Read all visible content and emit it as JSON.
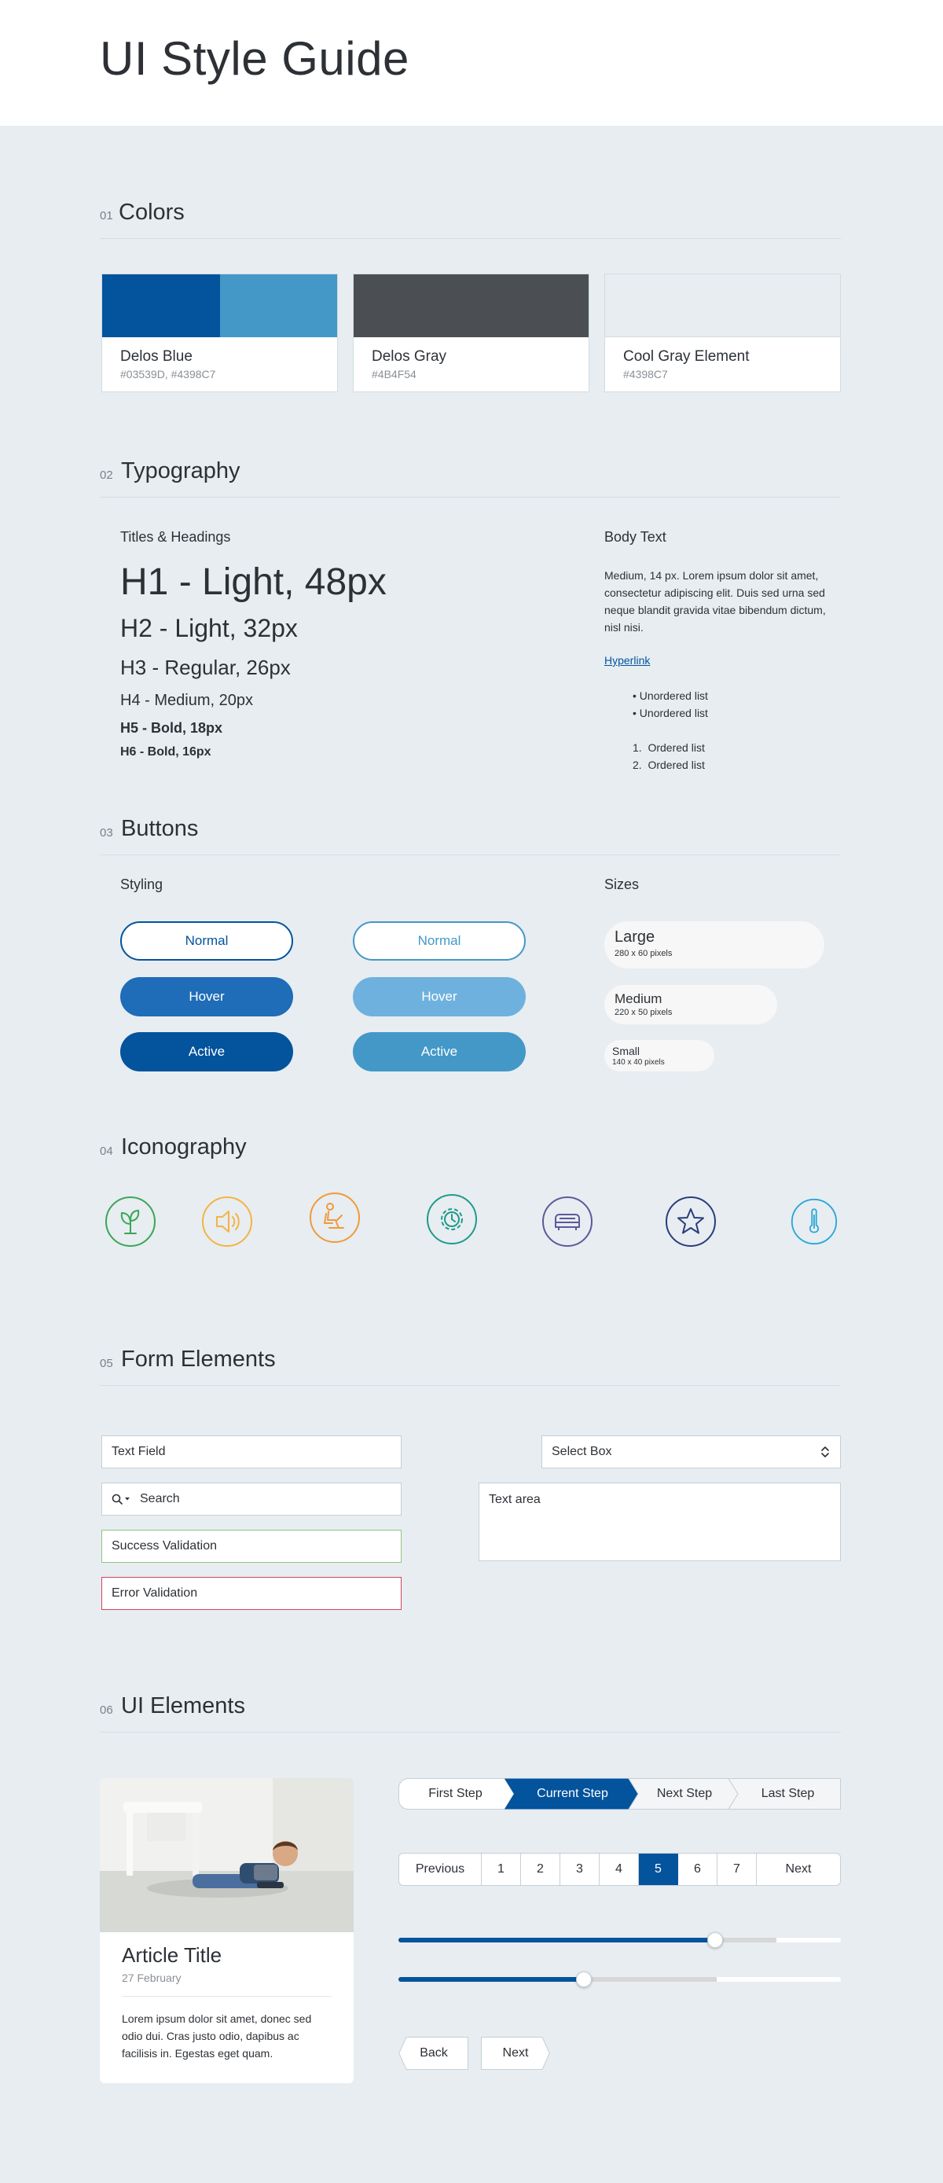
{
  "page": {
    "title": "UI Style Guide"
  },
  "colors_section": {
    "number": "01",
    "title": "Colors",
    "swatches": [
      {
        "name": "Delos Blue",
        "hex_label": "#03539D, #4398C7",
        "colors": [
          "#03539d",
          "#4398c7"
        ]
      },
      {
        "name": "Delos Gray",
        "hex_label": "#4B4F54",
        "colors": [
          "#4b4f54"
        ]
      },
      {
        "name": "Cool Gray Element",
        "hex_label": "#4398C7",
        "colors": [
          "#e7edf1"
        ]
      }
    ]
  },
  "typography_section": {
    "number": "02",
    "title": "Typography",
    "headings_label": "Titles & Headings",
    "h1": "H1 - Light, 48px",
    "h2": "H2 - Light, 32px",
    "h3": "H3 - Regular, 26px",
    "h4": "H4 - Medium, 20px",
    "h5": "H5 - Bold, 18px",
    "h6": "H6 - Bold, 16px",
    "body_label": "Body Text",
    "body_text": "Medium, 14 px. Lorem ipsum dolor sit amet, consectetur adipiscing elit. Duis sed urna sed neque blandit gravida vitae bibendum dictum, nisl nisi.",
    "hyperlink": "Hyperlink",
    "unordered": [
      "Unordered list",
      "Unordered list"
    ],
    "ordered": [
      "Ordered list",
      "Ordered list"
    ]
  },
  "buttons_section": {
    "number": "03",
    "title": "Buttons",
    "styling_label": "Styling",
    "sizes_label": "Sizes",
    "dark": {
      "normal": "Normal",
      "hover": "Hover",
      "active": "Active"
    },
    "light": {
      "normal": "Normal",
      "hover": "Hover",
      "active": "Active"
    },
    "sizes": [
      {
        "name": "Large",
        "dims": "280 x 60 pixels"
      },
      {
        "name": "Medium",
        "dims": "220 x 50 pixels"
      },
      {
        "name": "Small",
        "dims": "140 x 40 pixels"
      }
    ]
  },
  "iconography_section": {
    "number": "04",
    "title": "Iconography",
    "icons": [
      {
        "name": "plant-icon",
        "color": "#3aa655"
      },
      {
        "name": "speaker-icon",
        "color": "#f5b342"
      },
      {
        "name": "person-chair-icon",
        "color": "#f2993a"
      },
      {
        "name": "gear-clock-icon",
        "color": "#1f9a8a"
      },
      {
        "name": "bed-icon",
        "color": "#5a5a9a"
      },
      {
        "name": "star-icon",
        "color": "#2a3d7a"
      },
      {
        "name": "thermometer-icon",
        "color": "#2aa5d8"
      }
    ]
  },
  "forms_section": {
    "number": "05",
    "title": "Form Elements",
    "text_field": "Text Field",
    "search": "Search",
    "success": "Success Validation",
    "error": "Error Validation",
    "select_box": "Select Box",
    "text_area": "Text area"
  },
  "ui_section": {
    "number": "06",
    "title": "UI Elements",
    "article": {
      "title": "Article Title",
      "date": "27 February",
      "body": "Lorem ipsum dolor sit amet, donec sed odio dui. Cras justo odio, dapibus ac facilisis in. Egestas eget quam."
    },
    "steps": [
      "First Step",
      "Current Step",
      "Next Step",
      "Last Step"
    ],
    "pagination": {
      "previous": "Previous",
      "pages": [
        "1",
        "2",
        "3",
        "4",
        "5",
        "6",
        "7"
      ],
      "current": "5",
      "next": "Next"
    },
    "sliders": [
      {
        "value_fraction": 0.715,
        "buffer_fraction": 0.855
      },
      {
        "value_fraction": 0.42,
        "buffer_fraction": 0.72
      }
    ],
    "nav_buttons": {
      "back": "Back",
      "next": "Next"
    }
  },
  "theme": {
    "primary": "#03539d",
    "secondary": "#4398c7",
    "dark_gray": "#4b4f54",
    "background": "#e7edf1",
    "success": "#8fc77e",
    "error": "#d0455b"
  }
}
